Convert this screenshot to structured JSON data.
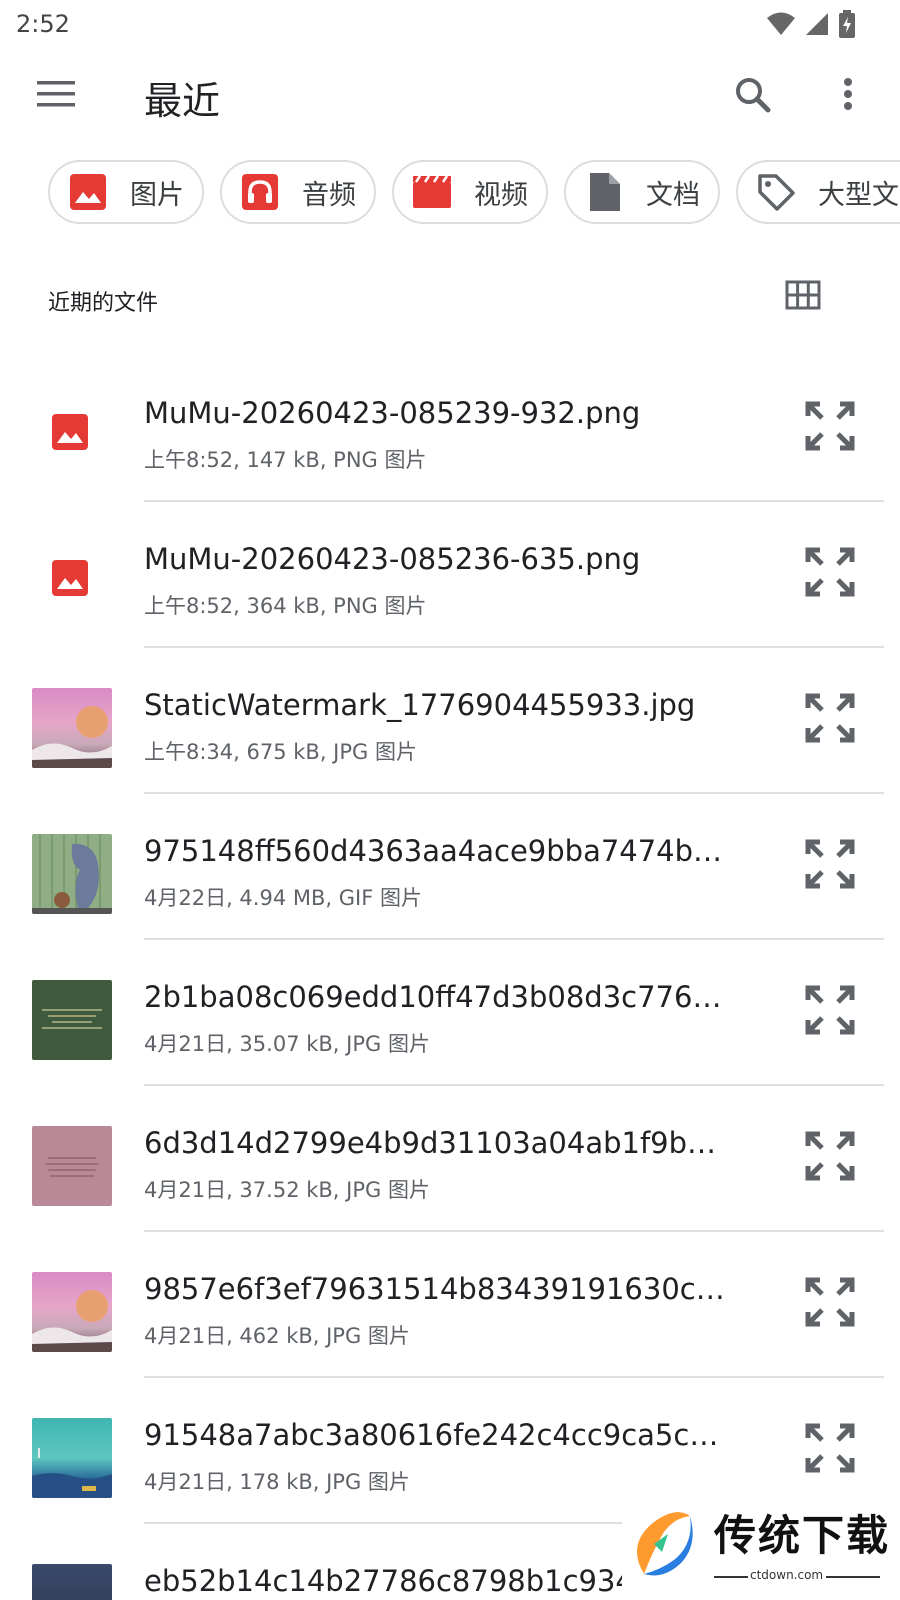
{
  "status_bar": {
    "time": "2:52"
  },
  "toolbar": {
    "title": "最近"
  },
  "chips": [
    {
      "label": "图片",
      "icon": "image-icon",
      "color": "#e53935"
    },
    {
      "label": "音频",
      "icon": "headphones-icon",
      "color": "#e53935"
    },
    {
      "label": "视频",
      "icon": "clapperboard-icon",
      "color": "#e53935"
    },
    {
      "label": "文档",
      "icon": "document-icon",
      "color": "#5f6368"
    },
    {
      "label": "大型文",
      "icon": "tag-icon",
      "color": "#5f6368"
    }
  ],
  "section": {
    "title": "近期的文件"
  },
  "files": [
    {
      "name": "MuMu-20260423-085239-932.png",
      "meta": "上午8:52, 147 kB, PNG 图片",
      "thumb": "image-icon"
    },
    {
      "name": "MuMu-20260423-085236-635.png",
      "meta": "上午8:52, 364 kB, PNG 图片",
      "thumb": "image-icon"
    },
    {
      "name": "StaticWatermark_1776904455933.jpg",
      "meta": "上午8:34, 675 kB, JPG 图片",
      "thumb": "pink-landscape"
    },
    {
      "name": "975148ff560d4363aa4ace9bba7474b4…",
      "meta": "4月22日, 4.94 MB, GIF 图片",
      "thumb": "cartoon-cat"
    },
    {
      "name": "2b1ba08c069edd10ff47d3b08d3c7763…",
      "meta": "4月21日, 35.07 kB, JPG 图片",
      "thumb": "green-text-card"
    },
    {
      "name": "6d3d14d2799e4b9d31103a04ab1f9b8…",
      "meta": "4月21日, 37.52 kB, JPG 图片",
      "thumb": "pink-text-card"
    },
    {
      "name": "9857e6f3ef79631514b83439191630ca…",
      "meta": "4月21日, 462 kB, JPG 图片",
      "thumb": "pink-landscape"
    },
    {
      "name": "91548a7abc3a80616fe242c4cc9ca5c2…",
      "meta": "4月21日, 178 kB, JPG 图片",
      "thumb": "ocean-scene"
    },
    {
      "name": "eb52b14c14b27786c8798b1c934",
      "meta": "",
      "thumb": "dark-scene"
    }
  ],
  "watermark": {
    "text": "传统下载",
    "sub": "ctdown.com"
  }
}
